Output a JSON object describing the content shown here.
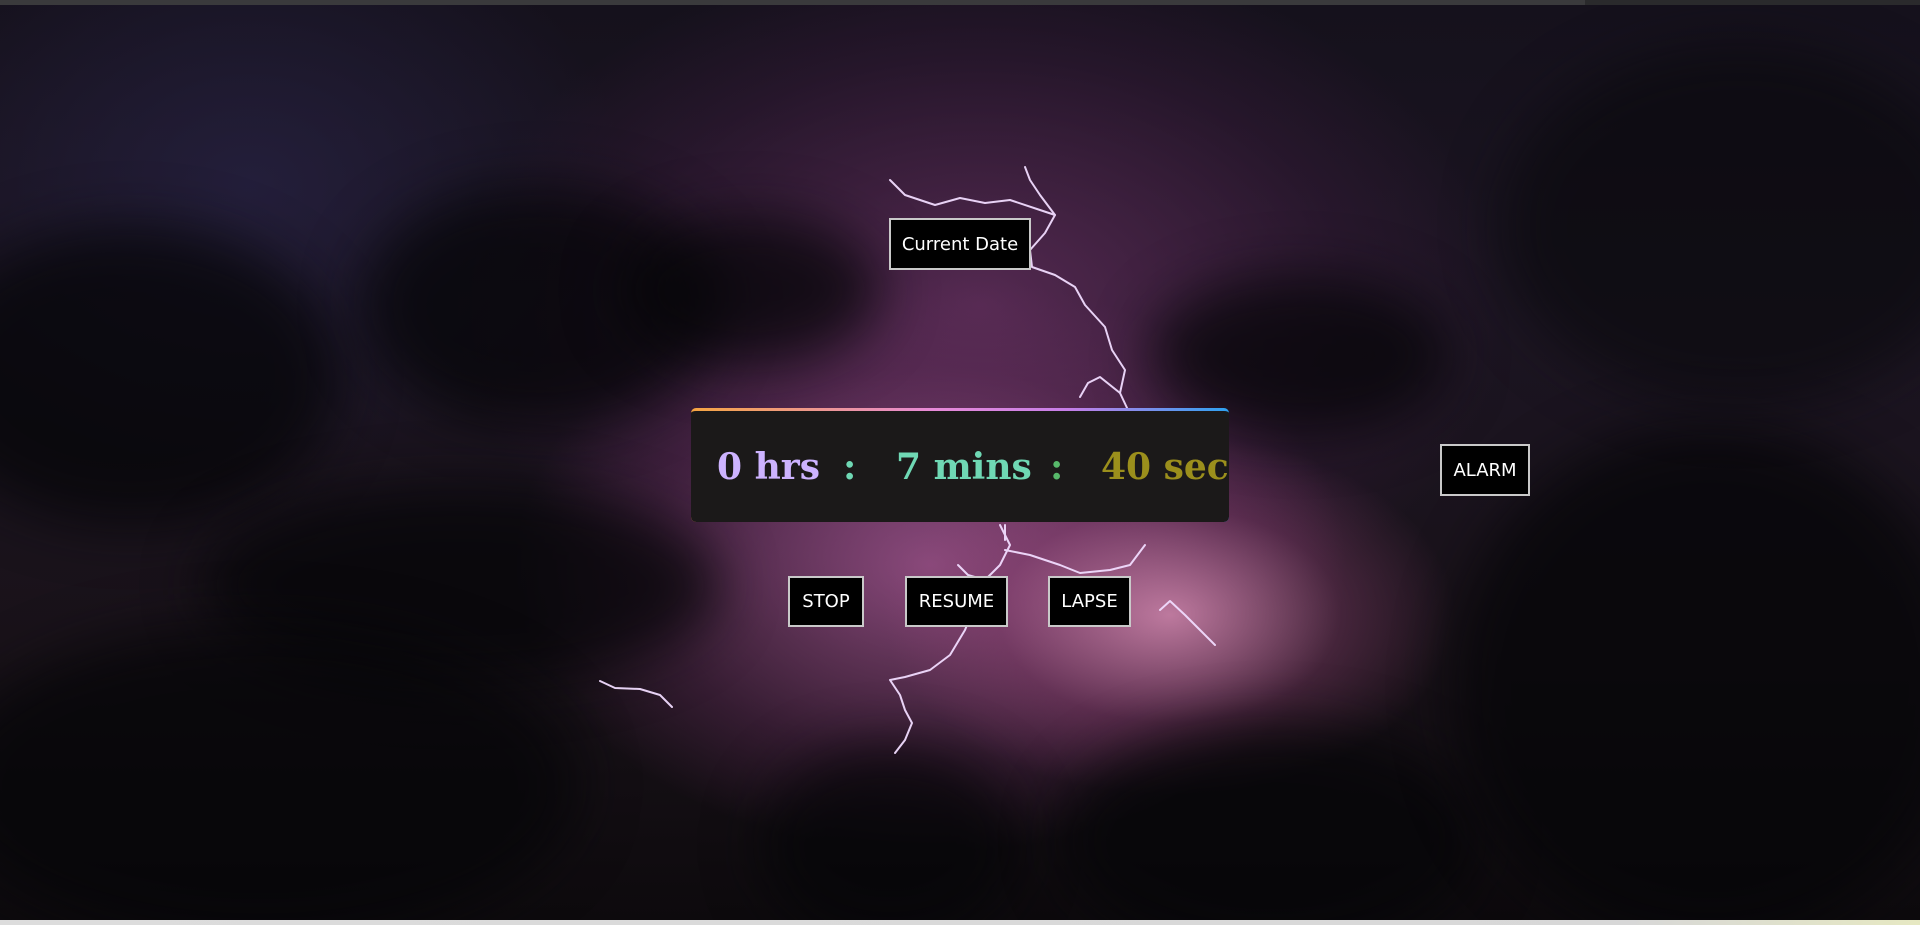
{
  "buttons": {
    "current_date": "Current Date",
    "alarm": "ALARM",
    "stop": "STOP",
    "resume": "RESUME",
    "lapse": "LAPSE"
  },
  "timer": {
    "hours": "0 hrs",
    "separator": ":",
    "minutes": "7 mins",
    "seconds": "40 sec"
  },
  "colors": {
    "hours": "#cdb3ff",
    "minutes": "#6fd8b4",
    "seconds": "#9b8f1c",
    "button_bg": "#000000",
    "panel_bg": "#1b1919"
  }
}
